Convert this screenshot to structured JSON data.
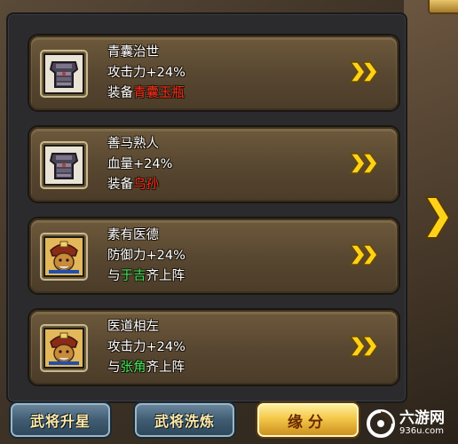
{
  "cards": [
    {
      "title": "青囊治世",
      "effect": "攻击力+24%",
      "req_prefix": "装备",
      "req_name": "青囊玉瓶",
      "req_suffix": "",
      "req_color": "red",
      "icon": "armor-icon"
    },
    {
      "title": "善马熟人",
      "effect": "血量+24%",
      "req_prefix": "装备",
      "req_name": "乌孙",
      "req_suffix": "",
      "req_color": "red",
      "icon": "armor-icon"
    },
    {
      "title": "素有医德",
      "effect": "防御力+24%",
      "req_prefix": "与",
      "req_name": "于吉",
      "req_suffix": "齐上阵",
      "req_color": "green",
      "icon": "general-portrait-icon"
    },
    {
      "title": "医道相左",
      "effect": "攻击力+24%",
      "req_prefix": "与",
      "req_name": "张角",
      "req_suffix": "齐上阵",
      "req_color": "green",
      "icon": "general-portrait-icon"
    }
  ],
  "buttons": {
    "star_up": "武将升星",
    "refine": "武将洗炼",
    "fate": "缘分"
  },
  "watermark": {
    "name": "六游网",
    "url": "936u.com"
  },
  "colors": {
    "red": "#ff2a16",
    "green": "#3fe35a",
    "chevron": "#ffd21a"
  }
}
